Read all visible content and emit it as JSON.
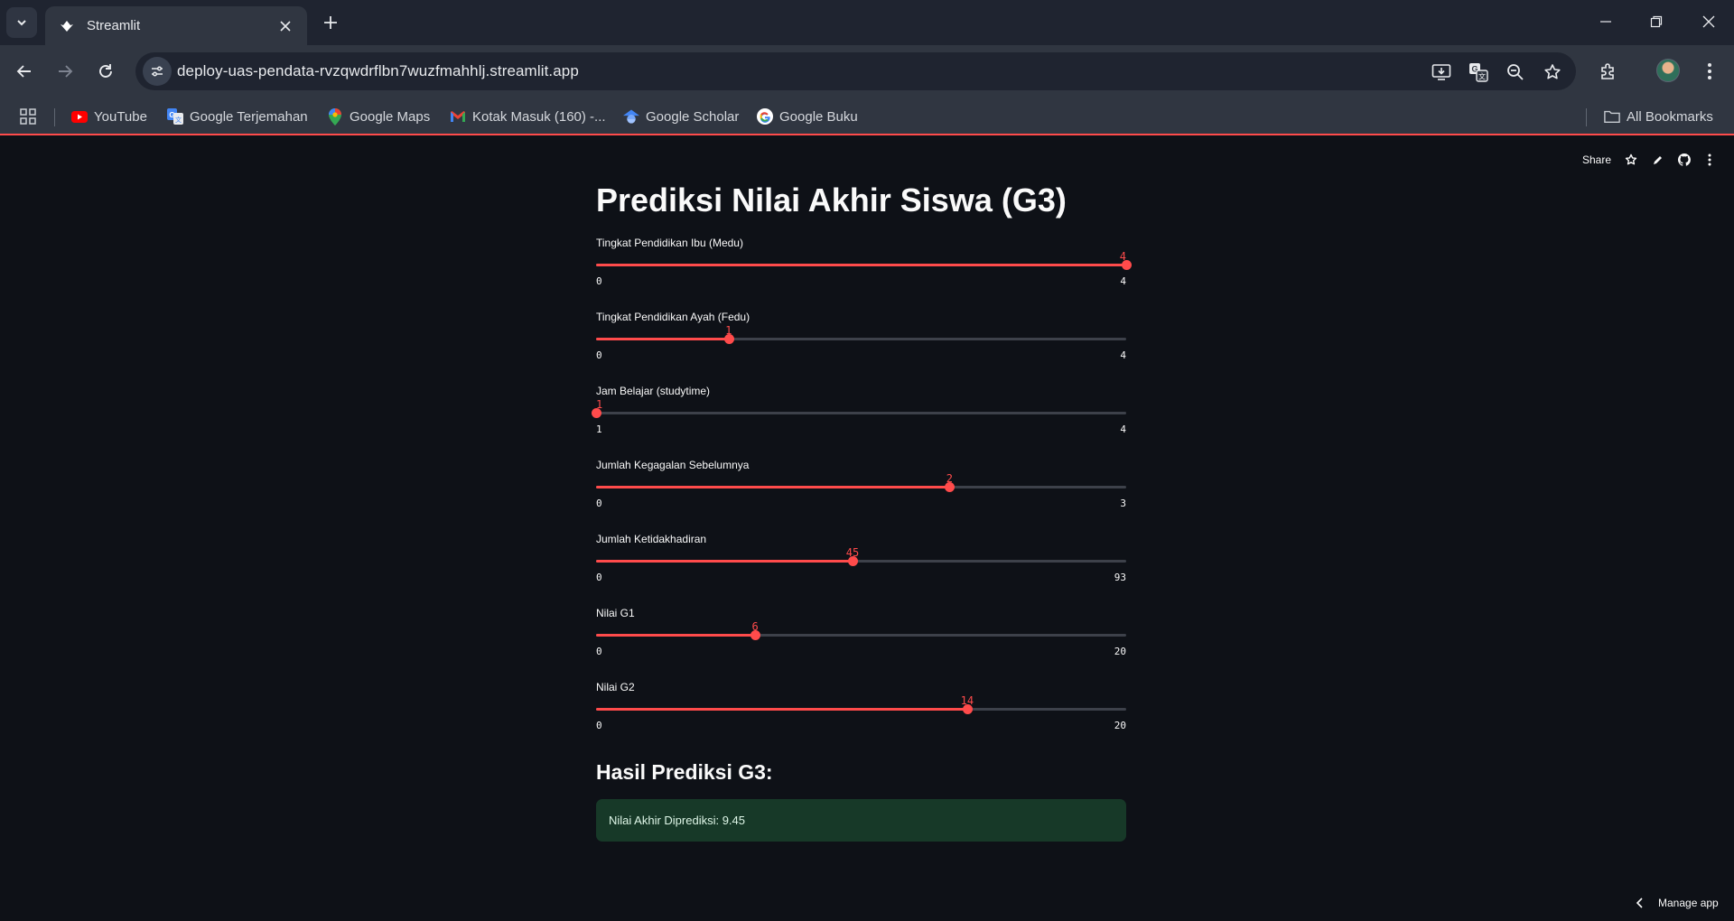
{
  "browser": {
    "tab_title": "Streamlit",
    "url": "deploy-uas-pendata-rvzqwdrflbn7wuzfmahhlj.streamlit.app",
    "bookmarks": [
      {
        "label": "YouTube",
        "icon": "youtube-icon"
      },
      {
        "label": "Google Terjemahan",
        "icon": "translate-icon"
      },
      {
        "label": "Google Maps",
        "icon": "maps-icon"
      },
      {
        "label": "Kotak Masuk (160) -...",
        "icon": "gmail-icon"
      },
      {
        "label": "Google Scholar",
        "icon": "scholar-icon"
      },
      {
        "label": "Google Buku",
        "icon": "google-icon"
      }
    ],
    "all_bookmarks": "All Bookmarks"
  },
  "app": {
    "header": {
      "share": "Share"
    },
    "title": "Prediksi Nilai Akhir Siswa (G3)",
    "sliders": [
      {
        "label": "Tingkat Pendidikan Ibu (Medu)",
        "min": "0",
        "max": "4",
        "value": "4",
        "min_num": 0,
        "max_num": 4,
        "value_num": 4
      },
      {
        "label": "Tingkat Pendidikan Ayah (Fedu)",
        "min": "0",
        "max": "4",
        "value": "1",
        "min_num": 0,
        "max_num": 4,
        "value_num": 1
      },
      {
        "label": "Jam Belajar (studytime)",
        "min": "1",
        "max": "4",
        "value": "1",
        "min_num": 1,
        "max_num": 4,
        "value_num": 1
      },
      {
        "label": "Jumlah Kegagalan Sebelumnya",
        "min": "0",
        "max": "3",
        "value": "2",
        "min_num": 0,
        "max_num": 3,
        "value_num": 2
      },
      {
        "label": "Jumlah Ketidakhadiran",
        "min": "0",
        "max": "93",
        "value": "45",
        "min_num": 0,
        "max_num": 93,
        "value_num": 45
      },
      {
        "label": "Nilai G1",
        "min": "0",
        "max": "20",
        "value": "6",
        "min_num": 0,
        "max_num": 20,
        "value_num": 6
      },
      {
        "label": "Nilai G2",
        "min": "0",
        "max": "20",
        "value": "14",
        "min_num": 0,
        "max_num": 20,
        "value_num": 14
      }
    ],
    "result_heading": "Hasil Prediksi G3:",
    "result_text": "Nilai Akhir Diprediksi: 9.45",
    "manage_app": "Manage app"
  },
  "colors": {
    "accent": "#ff4b4b",
    "background": "#0e1117",
    "success_bg": "#173928"
  }
}
